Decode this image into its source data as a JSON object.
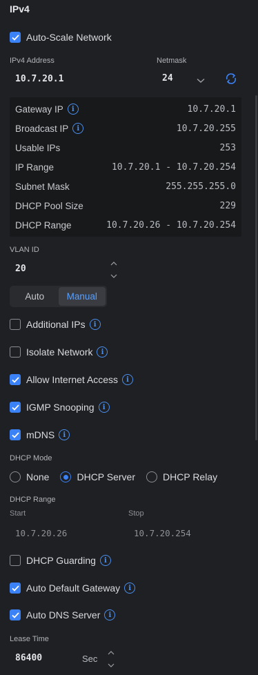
{
  "section": {
    "title": "IPv4"
  },
  "auto_scale": {
    "label": "Auto-Scale Network",
    "checked": true
  },
  "address": {
    "ipv4_label": "IPv4 Address",
    "ipv4_value": "10.7.20.1",
    "netmask_label": "Netmask",
    "netmask_value": "24"
  },
  "info": {
    "gateway": {
      "label": "Gateway IP",
      "value": "10.7.20.1"
    },
    "broadcast": {
      "label": "Broadcast IP",
      "value": "10.7.20.255"
    },
    "usable": {
      "label": "Usable IPs",
      "value": "253"
    },
    "range": {
      "label": "IP Range",
      "value": "10.7.20.1 - 10.7.20.254"
    },
    "subnet": {
      "label": "Subnet Mask",
      "value": "255.255.255.0"
    },
    "pool": {
      "label": "DHCP Pool Size",
      "value": "229"
    },
    "dhcp_range": {
      "label": "DHCP Range",
      "value": "10.7.20.26 - 10.7.20.254"
    }
  },
  "vlan": {
    "label": "VLAN ID",
    "value": "20"
  },
  "mode_toggle": {
    "auto": "Auto",
    "manual": "Manual",
    "selected": "Manual"
  },
  "options": {
    "additional_ips": {
      "label": "Additional IPs",
      "checked": false
    },
    "isolate": {
      "label": "Isolate Network",
      "checked": false
    },
    "internet": {
      "label": "Allow Internet Access",
      "checked": true
    },
    "igmp": {
      "label": "IGMP Snooping",
      "checked": true
    },
    "mdns": {
      "label": "mDNS",
      "checked": true
    }
  },
  "dhcp_mode": {
    "label": "DHCP Mode",
    "none": "None",
    "server": "DHCP Server",
    "relay": "DHCP Relay",
    "selected": "DHCP Server"
  },
  "dhcp_range": {
    "label": "DHCP Range",
    "start_label": "Start",
    "start_value": "10.7.20.26",
    "stop_label": "Stop",
    "stop_value": "10.7.20.254"
  },
  "dhcp_options": {
    "guarding": {
      "label": "DHCP Guarding",
      "checked": false
    },
    "auto_gateway": {
      "label": "Auto Default Gateway",
      "checked": true
    },
    "auto_dns": {
      "label": "Auto DNS Server",
      "checked": true
    }
  },
  "lease": {
    "label": "Lease Time",
    "value": "86400",
    "unit": "Sec"
  },
  "colors": {
    "accent": "#3b82f6",
    "background": "#1f2023",
    "panel": "#18191b"
  }
}
